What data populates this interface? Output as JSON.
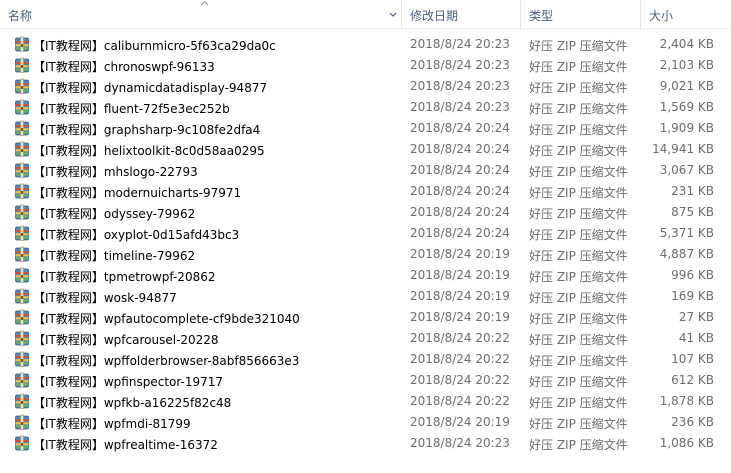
{
  "columns": {
    "name": "名称",
    "date": "修改日期",
    "type": "类型",
    "size": "大小"
  },
  "icons": {
    "file": "zip-archive-icon",
    "sort": "sort-ascending-icon",
    "dropdown": "chevron-down-icon"
  },
  "colors": {
    "header_text": "#4c607a",
    "meta_text": "#6d6d6d"
  },
  "files": [
    {
      "name": "【IT教程网】caliburnmicro-5f63ca29da0c",
      "date": "2018/8/24 20:23",
      "type": "好压 ZIP 压缩文件",
      "size": "2,404 KB"
    },
    {
      "name": "【IT教程网】chronoswpf-96133",
      "date": "2018/8/24 20:23",
      "type": "好压 ZIP 压缩文件",
      "size": "2,103 KB"
    },
    {
      "name": "【IT教程网】dynamicdatadisplay-94877",
      "date": "2018/8/24 20:23",
      "type": "好压 ZIP 压缩文件",
      "size": "9,021 KB"
    },
    {
      "name": "【IT教程网】fluent-72f5e3ec252b",
      "date": "2018/8/24 20:23",
      "type": "好压 ZIP 压缩文件",
      "size": "1,569 KB"
    },
    {
      "name": "【IT教程网】graphsharp-9c108fe2dfa4",
      "date": "2018/8/24 20:24",
      "type": "好压 ZIP 压缩文件",
      "size": "1,909 KB"
    },
    {
      "name": "【IT教程网】helixtoolkit-8c0d58aa0295",
      "date": "2018/8/24 20:24",
      "type": "好压 ZIP 压缩文件",
      "size": "14,941 KB"
    },
    {
      "name": "【IT教程网】mhslogo-22793",
      "date": "2018/8/24 20:24",
      "type": "好压 ZIP 压缩文件",
      "size": "3,067 KB"
    },
    {
      "name": "【IT教程网】modernuicharts-97971",
      "date": "2018/8/24 20:24",
      "type": "好压 ZIP 压缩文件",
      "size": "231 KB"
    },
    {
      "name": "【IT教程网】odyssey-79962",
      "date": "2018/8/24 20:24",
      "type": "好压 ZIP 压缩文件",
      "size": "875 KB"
    },
    {
      "name": "【IT教程网】oxyplot-0d15afd43bc3",
      "date": "2018/8/24 20:24",
      "type": "好压 ZIP 压缩文件",
      "size": "5,371 KB"
    },
    {
      "name": "【IT教程网】timeline-79962",
      "date": "2018/8/24 20:19",
      "type": "好压 ZIP 压缩文件",
      "size": "4,887 KB"
    },
    {
      "name": "【IT教程网】tpmetrowpf-20862",
      "date": "2018/8/24 20:19",
      "type": "好压 ZIP 压缩文件",
      "size": "996 KB"
    },
    {
      "name": "【IT教程网】wosk-94877",
      "date": "2018/8/24 20:19",
      "type": "好压 ZIP 压缩文件",
      "size": "169 KB"
    },
    {
      "name": "【IT教程网】wpfautocomplete-cf9bde321040",
      "date": "2018/8/24 20:19",
      "type": "好压 ZIP 压缩文件",
      "size": "27 KB"
    },
    {
      "name": "【IT教程网】wpfcarousel-20228",
      "date": "2018/8/24 20:22",
      "type": "好压 ZIP 压缩文件",
      "size": "41 KB"
    },
    {
      "name": "【IT教程网】wpffolderbrowser-8abf856663e3",
      "date": "2018/8/24 20:22",
      "type": "好压 ZIP 压缩文件",
      "size": "107 KB"
    },
    {
      "name": "【IT教程网】wpfinspector-19717",
      "date": "2018/8/24 20:22",
      "type": "好压 ZIP 压缩文件",
      "size": "612 KB"
    },
    {
      "name": "【IT教程网】wpfkb-a16225f82c48",
      "date": "2018/8/24 20:22",
      "type": "好压 ZIP 压缩文件",
      "size": "1,878 KB"
    },
    {
      "name": "【IT教程网】wpfmdi-81799",
      "date": "2018/8/24 20:19",
      "type": "好压 ZIP 压缩文件",
      "size": "236 KB"
    },
    {
      "name": "【IT教程网】wpfrealtime-16372",
      "date": "2018/8/24 20:23",
      "type": "好压 ZIP 压缩文件",
      "size": "1,086 KB"
    }
  ]
}
